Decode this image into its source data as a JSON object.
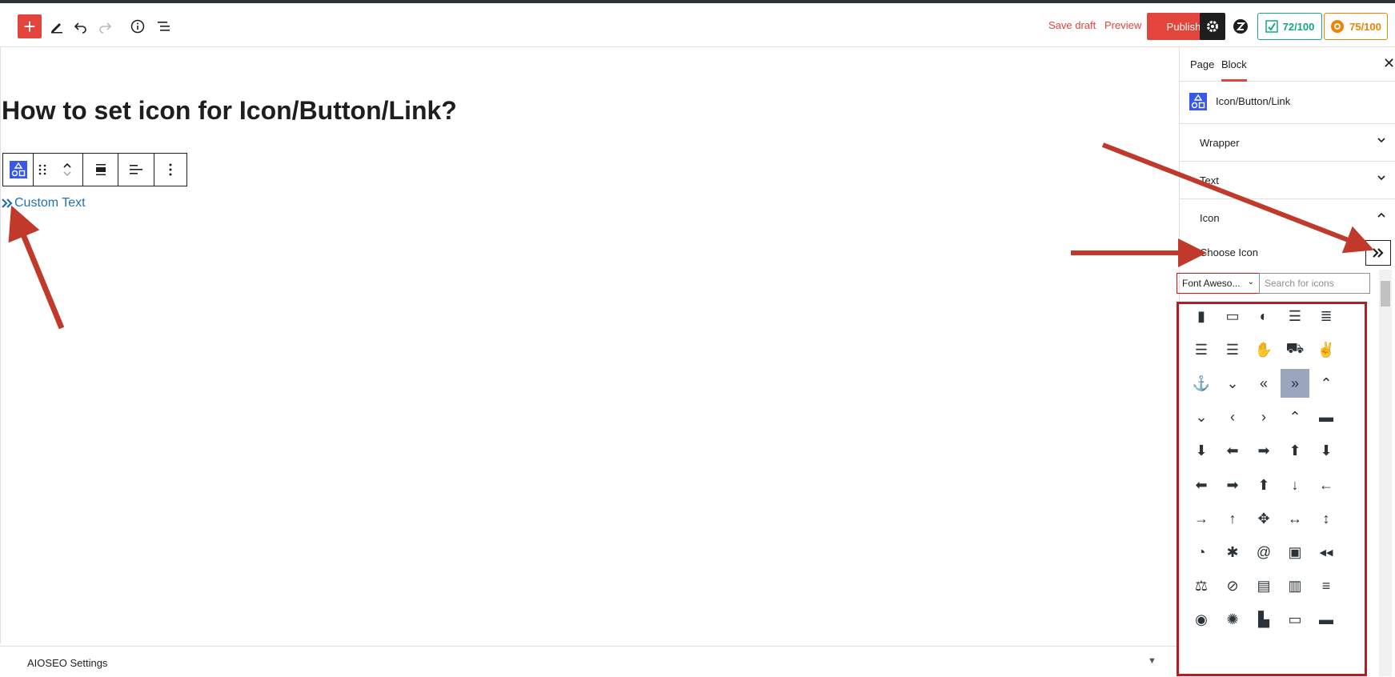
{
  "topbar": {
    "save_draft": "Save draft",
    "preview": "Preview",
    "publish": "Publish",
    "score_truseo": "72/100",
    "score_headline": "75/100"
  },
  "editor": {
    "post_title": "How to set icon for Icon/Button/Link?",
    "link_text": "Custom Text"
  },
  "footer": {
    "aioseo_label": "AIOSEO Settings"
  },
  "sidebar": {
    "tabs": [
      "Page",
      "Block"
    ],
    "active_tab": "Block",
    "block_name": "Icon/Button/Link",
    "panels": [
      "Wrapper",
      "Text",
      "Icon"
    ],
    "choose_icon_label": "Choose Icon",
    "icon_library_value": "Font Aweso...",
    "search_placeholder": "Search for icons"
  },
  "icon_grid": [
    [
      "address-book-icon",
      "address-card-icon",
      "adjust-icon",
      "align-center-icon",
      "align-justify-icon"
    ],
    [
      "align-left-icon",
      "align-right-icon",
      "hand-paper-icon",
      "ambulance-icon",
      "american-sign-language-icon"
    ],
    [
      "anchor-icon",
      "angle-double-down-icon",
      "angle-double-left-icon",
      "angle-double-right-icon",
      "angle-double-up-icon"
    ],
    [
      "angle-down-icon",
      "angle-left-icon",
      "angle-right-icon",
      "angle-up-icon",
      "archive-icon"
    ],
    [
      "arrow-circle-down-icon",
      "arrow-circle-left-icon",
      "arrow-circle-right-icon",
      "arrow-circle-up-icon",
      "arrow-circle-down-alt-icon"
    ],
    [
      "arrow-circle-left-alt-icon",
      "arrow-circle-right-alt-icon",
      "arrow-circle-up-alt-icon",
      "arrow-down-icon",
      "arrow-left-icon"
    ],
    [
      "arrow-right-icon",
      "arrow-up-icon",
      "arrows-alt-icon",
      "arrows-alt-h-icon",
      "arrows-alt-v-icon"
    ],
    [
      "assistive-listening-icon",
      "asterisk-icon",
      "at-icon",
      "audio-description-icon",
      "backward-icon"
    ],
    [
      "balance-scale-icon",
      "ban-icon",
      "band-aid-icon",
      "barcode-icon",
      "bars-icon"
    ],
    [
      "baseball-icon",
      "basketball-icon",
      "bath-icon",
      "battery-empty-icon",
      "battery-full-icon"
    ]
  ],
  "selected_icon": "angle-double-right-icon",
  "colors": {
    "accent": "#e2453c",
    "annotation_arrow": "#c0392b",
    "selected_icon_bg": "#9aa6bd",
    "link": "#2271b1"
  }
}
